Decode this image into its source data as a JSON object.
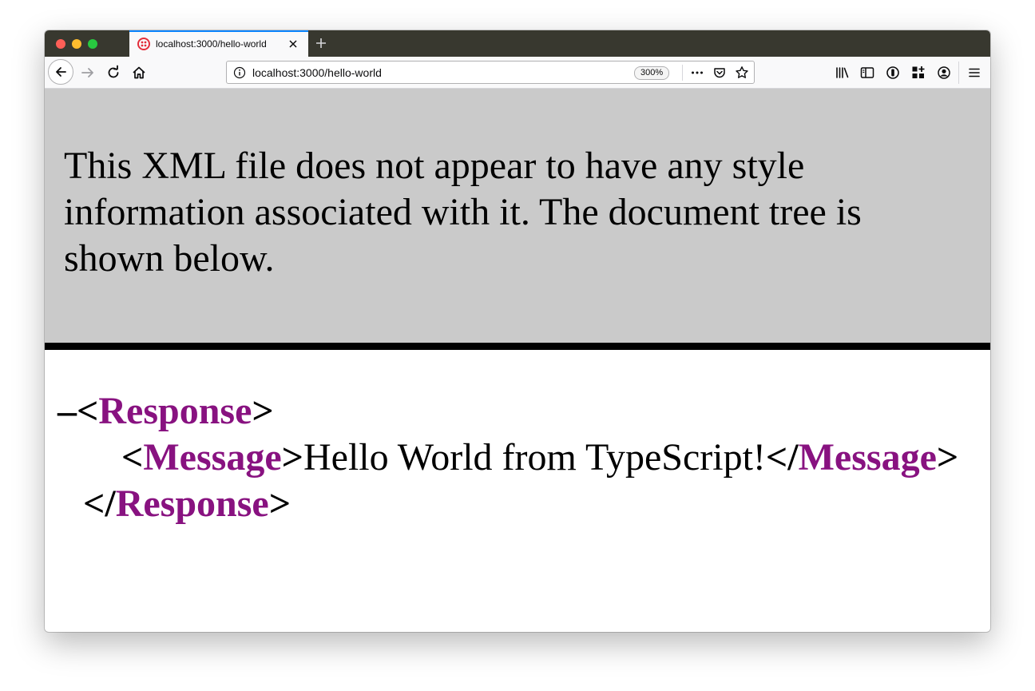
{
  "browser": {
    "tab": {
      "title": "localhost:3000/hello-world"
    },
    "url": "localhost:3000/hello-world",
    "zoom": "300%"
  },
  "page": {
    "info_message": "This XML file does not appear to have any style information associated with it. The document tree is shown below.",
    "tree": {
      "collapse_toggle": "–",
      "root_tag": "Response",
      "child_tag": "Message",
      "child_text": "Hello World from TypeScript!",
      "open_bracket": "<",
      "close_bracket": ">",
      "end_open": "</"
    }
  }
}
